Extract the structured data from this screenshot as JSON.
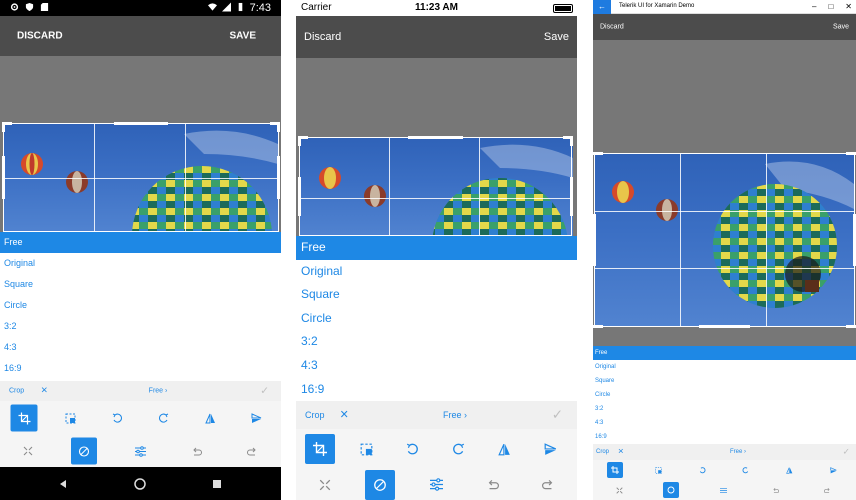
{
  "android": {
    "status": {
      "time": "7:43"
    },
    "header": {
      "discard": "DISCARD",
      "save": "SAVE"
    }
  },
  "ios": {
    "status": {
      "carrier": "Carrier",
      "time": "11:23 AM"
    },
    "header": {
      "discard": "Discard",
      "save": "Save"
    }
  },
  "uwp": {
    "window_title": "Telerik UI for Xamarin Demo",
    "header": {
      "discard": "Discard",
      "save": "Save"
    }
  },
  "options": [
    "Free",
    "Original",
    "Square",
    "Circle",
    "3:2",
    "4:3",
    "16:9"
  ],
  "selected_option": "Free",
  "cropbar": {
    "crop": "Crop",
    "free": "Free ›"
  },
  "colors": {
    "accent": "#1e88e5",
    "header_bg": "#4c4c4c",
    "canvas_bg": "#777777"
  },
  "toolbar_icons": {
    "row1": [
      "crop-icon",
      "selection-icon",
      "rotate-left-icon",
      "rotate-right-icon",
      "flip-vertical-icon",
      "flip-horizontal-icon"
    ],
    "row2": [
      "resize-icon",
      "hue-icon",
      "adjust-icon",
      "undo-icon",
      "redo-icon"
    ]
  }
}
